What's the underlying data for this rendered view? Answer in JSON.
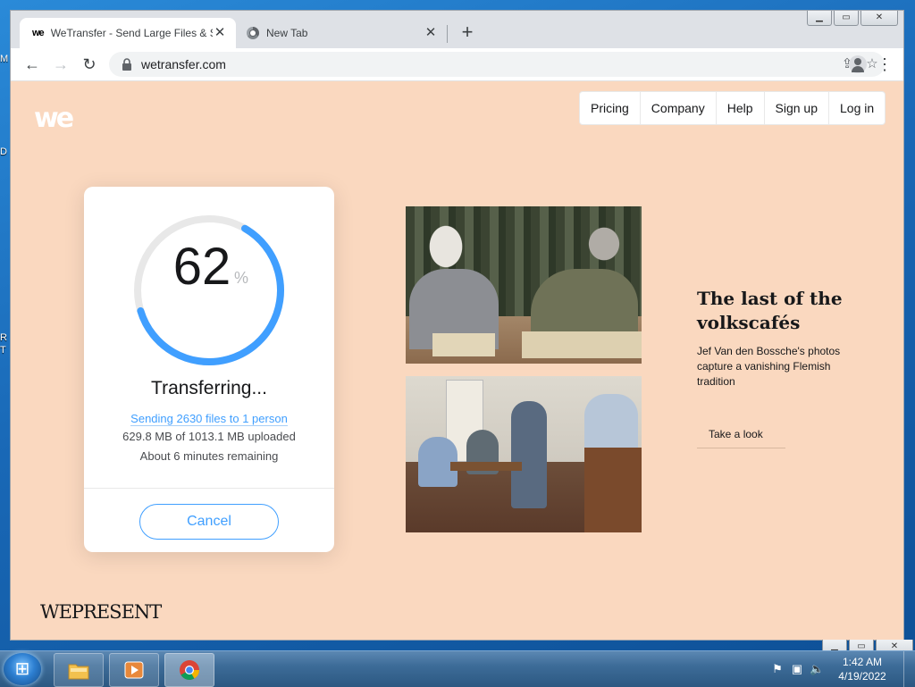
{
  "browser": {
    "tabs": [
      {
        "title": "WeTransfer - Send Large Files & Share Photos Online",
        "active": true
      },
      {
        "title": "New Tab",
        "active": false
      }
    ],
    "url": "wetransfer.com"
  },
  "nav": {
    "items": [
      "Pricing",
      "Company",
      "Help",
      "Sign up",
      "Log in"
    ]
  },
  "transfer": {
    "percent": "62",
    "percent_sign": "%",
    "progress_fraction": 0.62,
    "status": "Transferring...",
    "sending": "Sending 2630 files to 1 person",
    "uploaded": "629.8 MB of 1013.1 MB uploaded",
    "remaining": "About 6 minutes remaining",
    "cancel_label": "Cancel"
  },
  "feature": {
    "title": "The last of the volkscafés",
    "description": "Jef Van den Bossche's photos capture a vanishing Flemish tradition",
    "cta": "Take a look"
  },
  "brand": {
    "logo": "we",
    "wepresent": "WEPRESENT"
  },
  "taskbar": {
    "time": "1:42 AM",
    "date": "4/19/2022"
  },
  "colors": {
    "page_bg": "#fad8bf",
    "accent": "#409fff",
    "ring_track": "#e8e8e8"
  }
}
